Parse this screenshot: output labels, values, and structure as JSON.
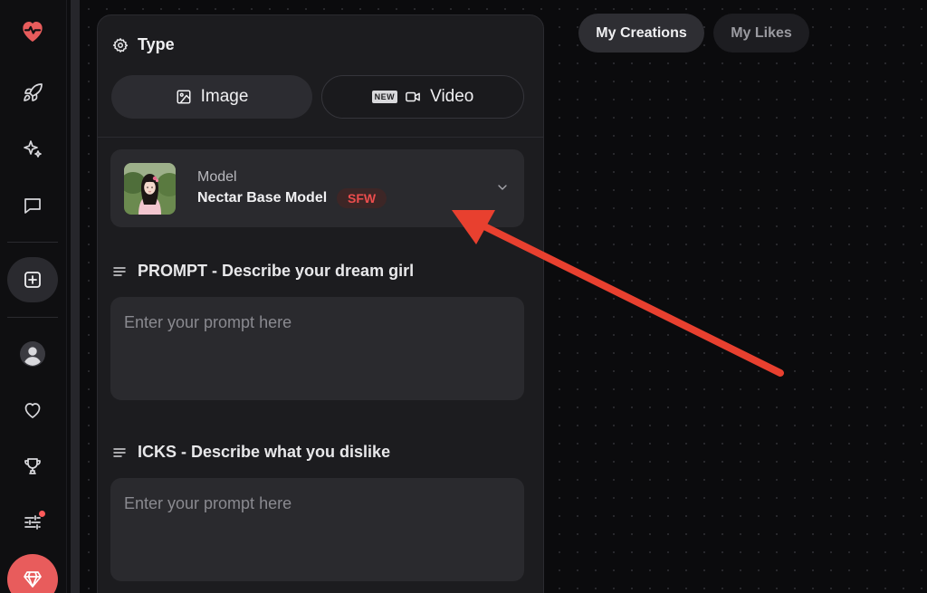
{
  "colors": {
    "brand": "#e85c5c",
    "badge_text": "#ec4d4d",
    "annotation_arrow": "#e8402f"
  },
  "sidebar": {
    "items": [
      {
        "icon": "heart-pulse-icon"
      },
      {
        "icon": "rocket-icon"
      },
      {
        "icon": "sparkles-icon"
      },
      {
        "icon": "chat-bubble-icon"
      },
      {
        "icon": "plus-square-icon",
        "active": true
      },
      {
        "icon": "user-avatar-icon"
      },
      {
        "icon": "heart-icon"
      },
      {
        "icon": "trophy-icon"
      },
      {
        "icon": "sliders-icon",
        "notification": true
      },
      {
        "icon": "diamond-icon",
        "premium": true
      }
    ]
  },
  "panel": {
    "type_title": "Type",
    "tabs": {
      "image_label": "Image",
      "new_badge": "NEW",
      "video_label": "Video"
    },
    "model": {
      "label": "Model",
      "name": "Nectar Base Model",
      "badge": "SFW"
    },
    "prompt": {
      "label": "PROMPT - Describe your dream girl",
      "placeholder": "Enter your prompt here"
    },
    "icks": {
      "label": "ICKS - Describe what you dislike",
      "placeholder": "Enter your prompt here"
    }
  },
  "top_tabs": {
    "my_creations": "My Creations",
    "my_likes": "My Likes"
  }
}
